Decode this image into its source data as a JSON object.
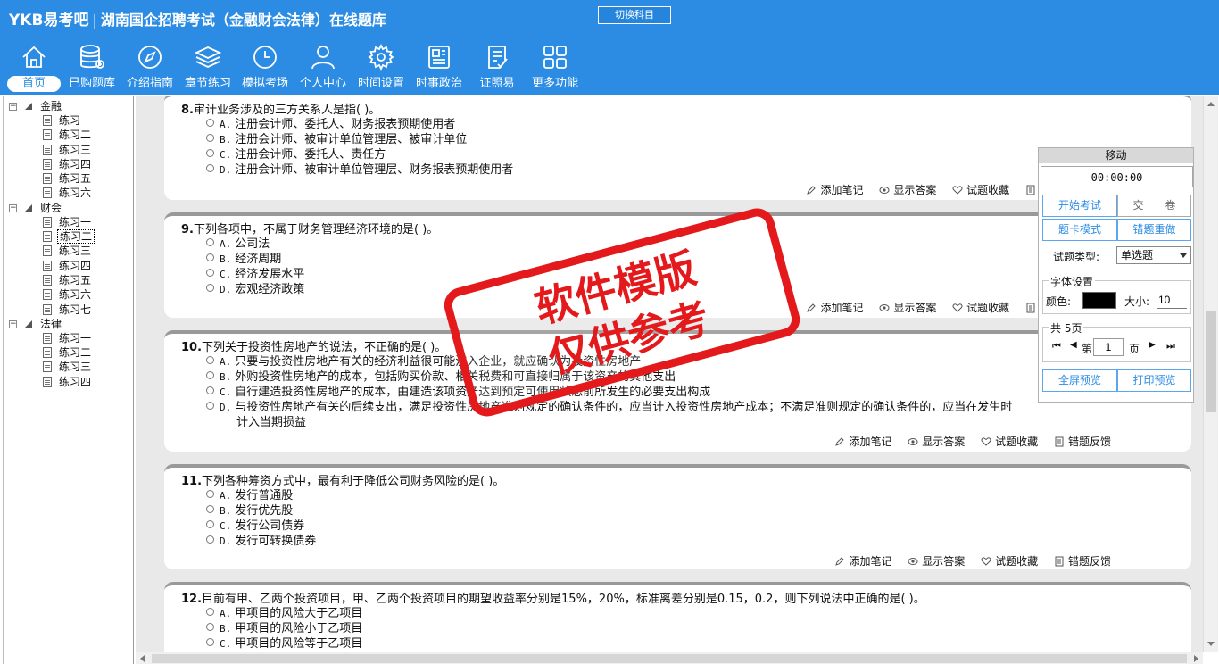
{
  "header": {
    "brand": "YKB易考吧",
    "separator": "|",
    "title": "湖南国企招聘考试（金融财会法律）在线题库",
    "switch_button": "切换科目"
  },
  "nav": [
    {
      "label": "首页",
      "icon": "home-icon",
      "active": true
    },
    {
      "label": "已购题库",
      "icon": "database-icon"
    },
    {
      "label": "介绍指南",
      "icon": "compass-icon"
    },
    {
      "label": "章节练习",
      "icon": "layers-icon"
    },
    {
      "label": "模拟考场",
      "icon": "clock-icon"
    },
    {
      "label": "个人中心",
      "icon": "user-icon"
    },
    {
      "label": "时间设置",
      "icon": "gear-icon"
    },
    {
      "label": "时事政治",
      "icon": "newspaper-icon"
    },
    {
      "label": "证照易",
      "icon": "checklist-icon"
    },
    {
      "label": "更多功能",
      "icon": "grid-icon"
    }
  ],
  "tree": [
    {
      "label": "金融",
      "items": [
        "练习一",
        "练习二",
        "练习三",
        "练习四",
        "练习五",
        "练习六"
      ]
    },
    {
      "label": "财会",
      "items": [
        "练习一",
        "练习二",
        "练习三",
        "练习四",
        "练习五",
        "练习六",
        "练习七"
      ],
      "selected_index": 1
    },
    {
      "label": "法律",
      "items": [
        "练习一",
        "练习二",
        "练习三",
        "练习四"
      ]
    }
  ],
  "actions": {
    "note": "添加笔记",
    "answer": "显示答案",
    "favorite": "试题收藏",
    "feedback": "错题反馈"
  },
  "questions": [
    {
      "number": "8.",
      "text": "审计业务涉及的三方关系人是指(  )。",
      "options": [
        {
          "letter": "A.",
          "text": "注册会计师、委托人、财务报表预期使用者"
        },
        {
          "letter": "B.",
          "text": "注册会计师、被审计单位管理层、被审计单位"
        },
        {
          "letter": "C.",
          "text": "注册会计师、委托人、责任方"
        },
        {
          "letter": "D.",
          "text": "注册会计师、被审计单位管理层、财务报表预期使用者"
        }
      ]
    },
    {
      "number": "9.",
      "text": "下列各项中，不属于财务管理经济环境的是(  )。",
      "options": [
        {
          "letter": "A.",
          "text": "公司法"
        },
        {
          "letter": "B.",
          "text": "经济周期"
        },
        {
          "letter": "C.",
          "text": "经济发展水平"
        },
        {
          "letter": "D.",
          "text": "宏观经济政策"
        }
      ]
    },
    {
      "number": "10.",
      "text": "下列关于投资性房地产的说法，不正确的是(  )。",
      "options": [
        {
          "letter": "A.",
          "text": "只要与投资性房地产有关的经济利益很可能流入企业，就应确认为投资性房地产"
        },
        {
          "letter": "B.",
          "text": "外购投资性房地产的成本，包括购买价款、相关税费和可直接归属于该资产的其他支出"
        },
        {
          "letter": "C.",
          "text": "自行建造投资性房地产的成本，由建造该项资产达到预定可使用状态前所发生的必要支出构成"
        },
        {
          "letter": "D.",
          "text": "与投资性房地产有关的后续支出，满足投资性房地产准则规定的确认条件的，应当计入投资性房地产成本；不满足准则规定的确认条件的，应当在发生时",
          "cont": "计入当期损益"
        }
      ]
    },
    {
      "number": "11.",
      "text": "下列各种筹资方式中，最有利于降低公司财务风险的是(  )。",
      "options": [
        {
          "letter": "A.",
          "text": "发行普通股"
        },
        {
          "letter": "B.",
          "text": "发行优先股"
        },
        {
          "letter": "C.",
          "text": "发行公司债券"
        },
        {
          "letter": "D.",
          "text": "发行可转换债券"
        }
      ]
    },
    {
      "number": "12.",
      "text": "目前有甲、乙两个投资项目，甲、乙两个投资项目的期望收益率分别是15%，20%，标准离差分别是0.15，0.2，则下列说法中正确的是(  )。",
      "options": [
        {
          "letter": "A.",
          "text": "甲项目的风险大于乙项目"
        },
        {
          "letter": "B.",
          "text": "甲项目的风险小于乙项目"
        },
        {
          "letter": "C.",
          "text": "甲项目的风险等于乙项目"
        }
      ]
    }
  ],
  "panel": {
    "title": "移动",
    "timer": "00:00:00",
    "start_exam": "开始考试",
    "submit": "交　　卷",
    "card_mode": "题卡模式",
    "redo_wrong": "错题重做",
    "qtype_label": "试题类型:",
    "qtype_value": "单选题",
    "font_legend": "字体设置",
    "color_label": "颜色:",
    "size_label": "大小:",
    "font_size": "10",
    "color_value": "#000000",
    "pages_legend": "共 5页",
    "page_prefix": "第",
    "page_suffix": "页",
    "page_value": "1",
    "fullscreen": "全屏预览",
    "print": "打印预览"
  },
  "watermark": {
    "line1": "软件模版",
    "line2": "仅供参考"
  }
}
